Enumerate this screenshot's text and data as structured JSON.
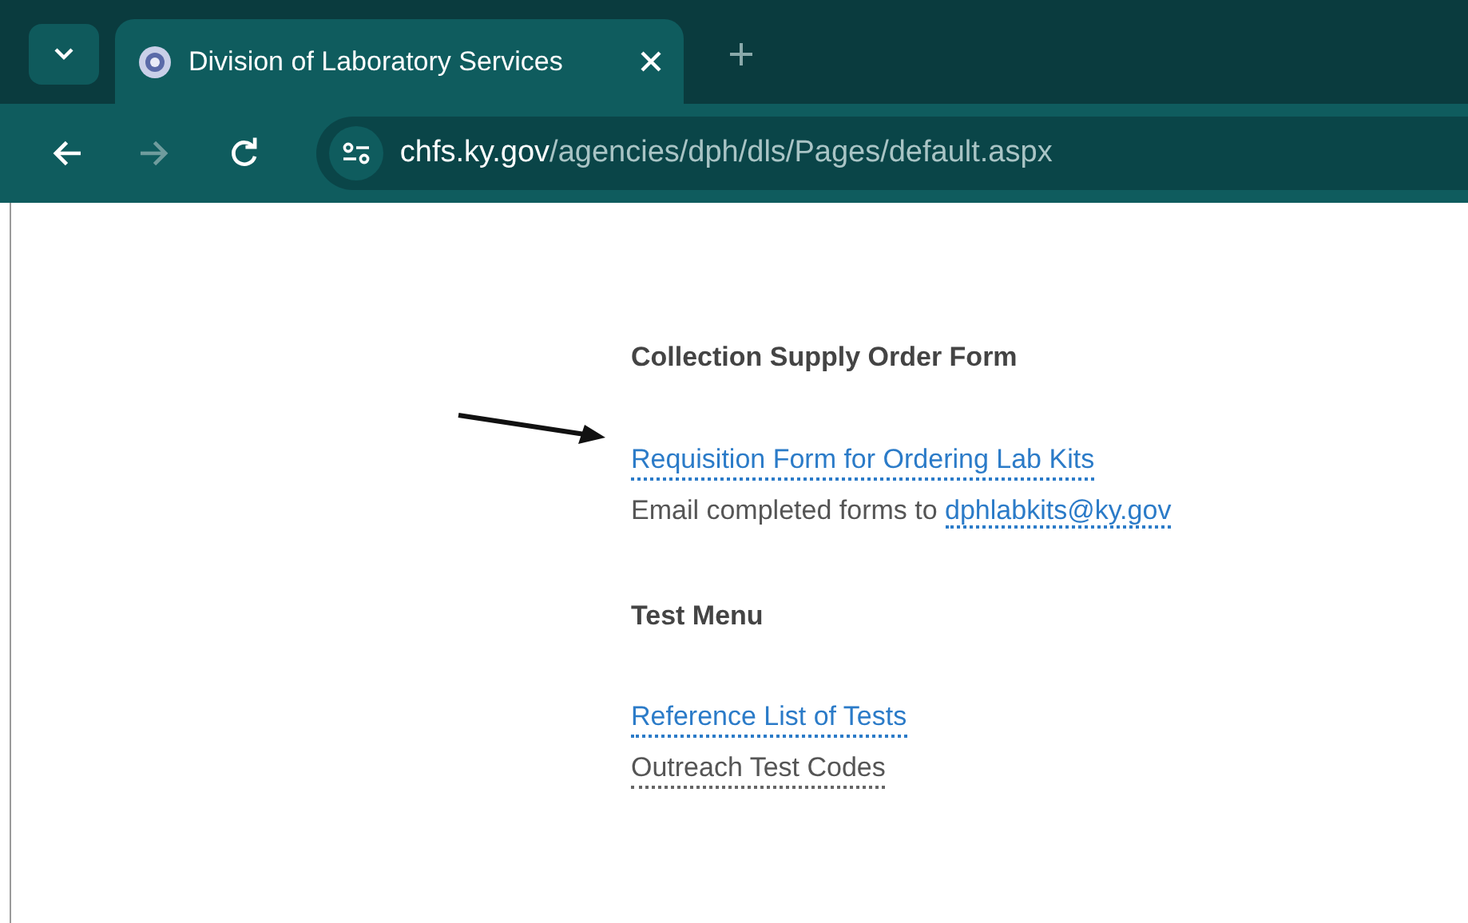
{
  "browser": {
    "tab": {
      "title": "Division of Laboratory Services",
      "selected": true
    },
    "address": {
      "host": "chfs.ky.gov",
      "path": "/agencies/dph/dls/Pages/default.aspx"
    }
  },
  "sections": [
    {
      "heading": "Collection Supply Order Form",
      "annotated": true,
      "lines": [
        {
          "kind": "link",
          "text": "Requisition Form for Ordering Lab Kits"
        },
        {
          "kind": "mixed",
          "text": "Email completed forms to",
          "link": "dphlabkits@ky.gov"
        }
      ]
    },
    {
      "heading": "Test Menu",
      "annotated": false,
      "lines": [
        {
          "kind": "link",
          "text": "Reference List of Tests"
        },
        {
          "kind": "plain",
          "text": "Outreach Test Codes"
        }
      ]
    }
  ]
}
